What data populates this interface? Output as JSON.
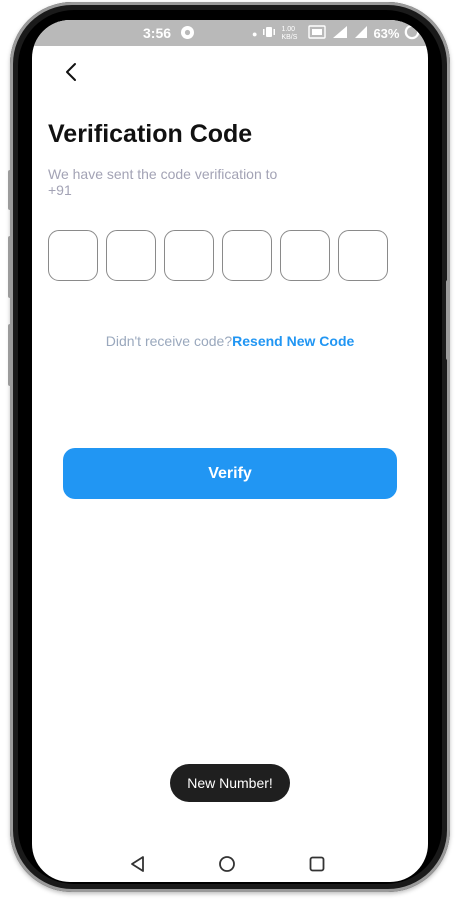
{
  "status_bar": {
    "time": "3:56",
    "speed": "1.00 KB/S",
    "battery": "63%"
  },
  "screen": {
    "title": "Verification Code",
    "subtitle_line1": "We have sent the code verification to",
    "subtitle_line2": "+91",
    "otp_boxes": [
      "",
      "",
      "",
      "",
      "",
      ""
    ],
    "resend_question": "Didn't receive code?",
    "resend_link": "Resend New Code",
    "verify_button": "Verify"
  },
  "toast": {
    "message": "New Number!"
  },
  "colors": {
    "accent": "#2196f3",
    "title": "#111111",
    "muted": "#a3a3b5",
    "toast_bg": "#1f1f1f"
  }
}
